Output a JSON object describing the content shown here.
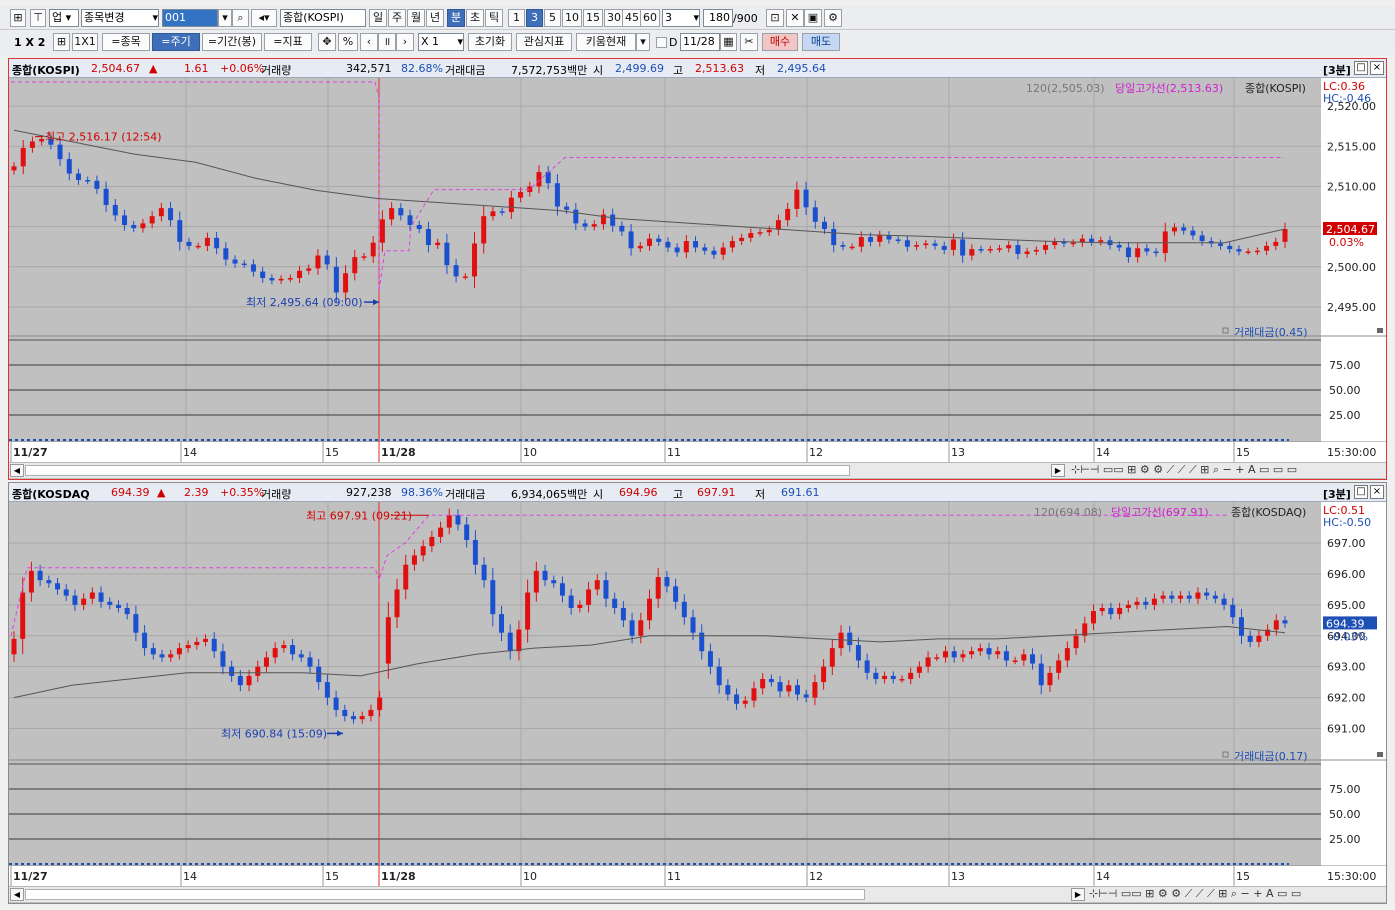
{
  "toolbar1": {
    "market": "업",
    "item_change": "종목변경",
    "code": "001",
    "name": "종합(KOSPI)",
    "periods": [
      "일",
      "주",
      "월",
      "년",
      "분",
      "초",
      "틱"
    ],
    "period_selected": "분",
    "intervals": [
      "1",
      "3",
      "5",
      "10",
      "15",
      "30",
      "45",
      "60"
    ],
    "interval_selected": "3",
    "interval_value": "3",
    "count": "180",
    "count_max": "/900"
  },
  "toolbar2": {
    "layout": "1 X 2",
    "grid": "1X1",
    "btn_item": "=종목",
    "btn_period": "=주기",
    "btn_range": "=기간(봉)",
    "btn_indicator": "=지표",
    "pct": "%",
    "mult": "X 1",
    "btn_reset": "초기화",
    "btn_watch": "관심지표",
    "btn_kiwoom": "키움현재",
    "chk_d": "D",
    "date": "11/28",
    "buy": "매수",
    "sell": "매도"
  },
  "panel1": {
    "title": "종합(KOSPI)",
    "price": "2,504.67",
    "arrow": "▲",
    "change": "1.61",
    "pct": "+0.06%",
    "vol_label": "거래량",
    "vol": "342,571",
    "vol_ratio": "82.68%",
    "amt_label": "거래대금",
    "amt": "7,572,753백만",
    "open_label": "시",
    "open": "2,499.69",
    "high_label": "고",
    "high": "2,513.63",
    "low_label": "저",
    "low": "2,495.64",
    "period": "[3분]",
    "legend_ma": "120(2,505.03)",
    "legend_high": "당일고가선(2,513.63)",
    "legend_name": "종합(KOSPI)",
    "lc": "LC:0.36",
    "hc": "HC:-0.46",
    "max_label": "최고 2,516.17 (12:54)",
    "min_label": "최저 2,495.64 (09:00)",
    "last_price": "2,504.67",
    "last_pct": "0.03%",
    "y_ticks": [
      "2,520.00",
      "2,515.00",
      "2,510.00",
      "2,505.00",
      "2,500.00",
      "2,495.00"
    ],
    "sub_legend": "거래대금(0.45)",
    "sub_ticks": [
      "75.00",
      "50.00",
      "25.00"
    ],
    "x_labels": [
      "11/27",
      "14",
      "15",
      "11/28",
      "10",
      "11",
      "12",
      "13",
      "14",
      "15"
    ],
    "time_label": "15:30:00"
  },
  "panel2": {
    "title": "종합(KOSDAQ",
    "price": "694.39",
    "arrow": "▲",
    "change": "2.39",
    "pct": "+0.35%",
    "vol_label": "거래량",
    "vol": "927,238",
    "vol_ratio": "98.36%",
    "amt_label": "거래대금",
    "amt": "6,934,065백만",
    "open_label": "시",
    "open": "694.96",
    "high_label": "고",
    "high": "697.91",
    "low_label": "저",
    "low": "691.61",
    "period": "[3분]",
    "legend_ma": "120(694.08)",
    "legend_high": "당일고가선(697.91)",
    "legend_name": "종합(KOSDAQ)",
    "lc": "LC:0.51",
    "hc": "HC:-0.50",
    "max_label": "최고 697.91 (09:21)",
    "min_label": "최저 690.84 (15:09)",
    "last_price": "694.39",
    "last_pct": "-0.03%",
    "y_ticks": [
      "697.00",
      "696.00",
      "695.00",
      "694.00",
      "693.00",
      "692.00",
      "691.00"
    ],
    "sub_legend": "거래대금(0.17)",
    "sub_ticks": [
      "75.00",
      "50.00",
      "25.00"
    ],
    "x_labels": [
      "11/27",
      "14",
      "15",
      "11/28",
      "10",
      "11",
      "12",
      "13",
      "14",
      "15"
    ],
    "time_label": "15:30:00"
  },
  "chart_data": [
    {
      "type": "candlestick",
      "title": "종합(KOSPI)",
      "interval": "3분",
      "ylim": [
        2493,
        2523
      ],
      "grid": true,
      "series": [
        {
          "name": "close",
          "values": [
            2512.5,
            2514.8,
            2515.6,
            2515.9,
            2515.2,
            2513.4,
            2511.6,
            2510.8,
            2510.7,
            2509.7,
            2507.7,
            2506.4,
            2505.2,
            2504.8,
            2505.4,
            2506.3,
            2507.3,
            2505.8,
            2503.1,
            2502.6,
            2502.6,
            2503.6,
            2502.3,
            2500.9,
            2500.4,
            2500.3,
            2499.4,
            2498.6,
            2498.3,
            2498.5,
            2498.6,
            2499.5,
            2499.8,
            2501.4,
            2500.3,
            2496.8,
            2499.2,
            2501.2,
            2501.3,
            2503.0,
            2505.9,
            2507.3,
            2506.4,
            2505.2,
            2504.7,
            2502.7,
            2503.0,
            2500.2,
            2498.8,
            2498.8,
            2502.9,
            2506.3,
            2506.9,
            2506.8,
            2508.6,
            2509.3,
            2510.0,
            2511.8,
            2510.4,
            2507.5,
            2507.1,
            2505.4,
            2505.0,
            2505.3,
            2506.5,
            2505.1,
            2504.4,
            2502.3,
            2502.6,
            2503.5,
            2503.1,
            2502.4,
            2501.8,
            2503.2,
            2502.4,
            2502.0,
            2501.5,
            2502.4,
            2503.2,
            2503.6,
            2504.2,
            2504.3,
            2504.6,
            2505.8,
            2507.2,
            2509.6,
            2507.4,
            2505.6,
            2504.7,
            2502.7,
            2502.5,
            2502.5,
            2503.7,
            2503.1,
            2503.9,
            2503.4,
            2503.3,
            2502.5,
            2502.7,
            2502.9,
            2502.6,
            2502.1,
            2503.4,
            2501.4,
            2502.2,
            2502.1,
            2502.2,
            2502.3,
            2502.7,
            2501.6,
            2501.9,
            2502.1,
            2502.7,
            2503.1,
            2502.9,
            2503.0,
            2503.5,
            2503.1,
            2503.3,
            2502.7,
            2502.4,
            2501.2,
            2502.3,
            2501.9,
            2501.7,
            2504.4,
            2504.9,
            2504.5,
            2503.9,
            2503.2,
            2502.9,
            2502.6,
            2502.2,
            2501.9,
            2501.9,
            2502.0,
            2502.6,
            2503.1,
            2504.7
          ]
        },
        {
          "name": "120",
          "values": [
            2517,
            2515.5,
            2514,
            2513,
            2511,
            2509.5,
            2508.5,
            2508,
            2507.5,
            2507,
            2506,
            2505.5,
            2505,
            2504.5,
            2504,
            2503.8,
            2503.5,
            2503.2,
            2503,
            2503,
            2503,
            2504.7
          ]
        }
      ]
    },
    {
      "type": "candlestick",
      "title": "종합(KOSDAQ",
      "interval": "3분",
      "ylim": [
        690.4,
        698.2
      ],
      "grid": true,
      "series": [
        {
          "name": "close",
          "values": [
            693.9,
            695.4,
            696.1,
            695.8,
            695.7,
            695.5,
            695.3,
            695.0,
            695.2,
            695.4,
            695.1,
            695.0,
            694.9,
            694.7,
            694.1,
            693.6,
            693.4,
            693.3,
            693.4,
            693.6,
            693.7,
            693.8,
            693.9,
            693.5,
            693.0,
            692.7,
            692.4,
            692.7,
            693.0,
            693.3,
            693.6,
            693.7,
            693.4,
            693.3,
            693.0,
            692.5,
            692.0,
            691.6,
            691.4,
            691.3,
            691.4,
            691.6,
            692.0,
            694.6,
            695.5,
            696.3,
            696.6,
            696.9,
            697.2,
            697.5,
            697.9,
            697.6,
            697.1,
            696.3,
            695.8,
            694.7,
            694.1,
            693.5,
            694.2,
            695.4,
            696.1,
            695.8,
            695.7,
            695.3,
            694.9,
            695.0,
            695.5,
            695.8,
            695.2,
            694.9,
            694.5,
            694.0,
            694.5,
            695.2,
            695.9,
            695.6,
            695.1,
            694.6,
            694.1,
            693.5,
            693.0,
            692.4,
            692.1,
            691.8,
            691.9,
            692.3,
            692.6,
            692.5,
            692.2,
            692.4,
            692.1,
            692.0,
            692.5,
            693.0,
            693.6,
            694.1,
            693.7,
            693.2,
            692.8,
            692.6,
            692.7,
            692.6,
            692.6,
            692.8,
            693.0,
            693.3,
            693.3,
            693.5,
            693.3,
            693.4,
            693.5,
            693.6,
            693.4,
            693.5,
            693.2,
            693.2,
            693.4,
            693.1,
            692.4,
            692.8,
            693.2,
            693.6,
            694.0,
            694.4,
            694.8,
            694.9,
            694.7,
            694.9,
            695.0,
            695.1,
            695.0,
            695.2,
            695.3,
            695.2,
            695.3,
            695.2,
            695.4,
            695.3,
            695.2,
            695.0,
            694.6,
            694.0,
            693.8,
            694.0,
            694.2,
            694.5,
            694.4
          ]
        },
        {
          "name": "120",
          "values": [
            692,
            692.4,
            692.6,
            692.8,
            692.8,
            692.8,
            692.7,
            693.1,
            693.4,
            693.6,
            693.7,
            694.0,
            694.0,
            694.0,
            693.9,
            693.8,
            693.9,
            693.9,
            694.0,
            694.1,
            694.2,
            694.3,
            694.1
          ]
        }
      ]
    }
  ]
}
